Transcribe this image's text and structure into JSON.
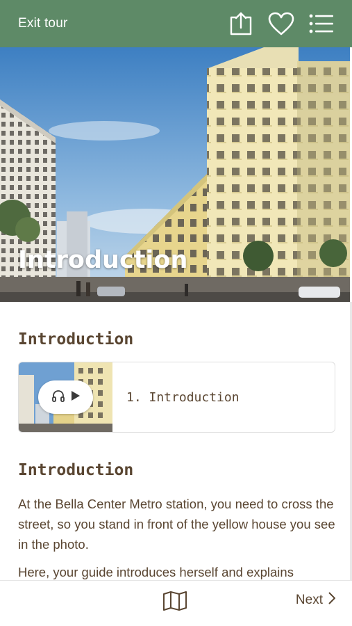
{
  "header": {
    "exit_label": "Exit tour",
    "icons": [
      "share-icon",
      "heart-icon",
      "menu-icon"
    ]
  },
  "hero": {
    "title": "Introduction"
  },
  "main": {
    "section1_title": "Introduction",
    "audio_track": {
      "label": "1. Introduction",
      "icons": [
        "headphones-icon",
        "play-icon"
      ]
    },
    "section2_title": "Introduction",
    "paragraphs": [
      "At the Bella Center Metro station, you need to cross the street, so you stand in front of the yellow house you see in the photo.",
      "Here, your guide introduces herself and explains"
    ]
  },
  "footer": {
    "map_icon": "map-icon",
    "next_label": "Next"
  },
  "colors": {
    "header_bg": "#5e8a67",
    "text_brown": "#5a4632",
    "building_yellow": "#e6d48a"
  }
}
